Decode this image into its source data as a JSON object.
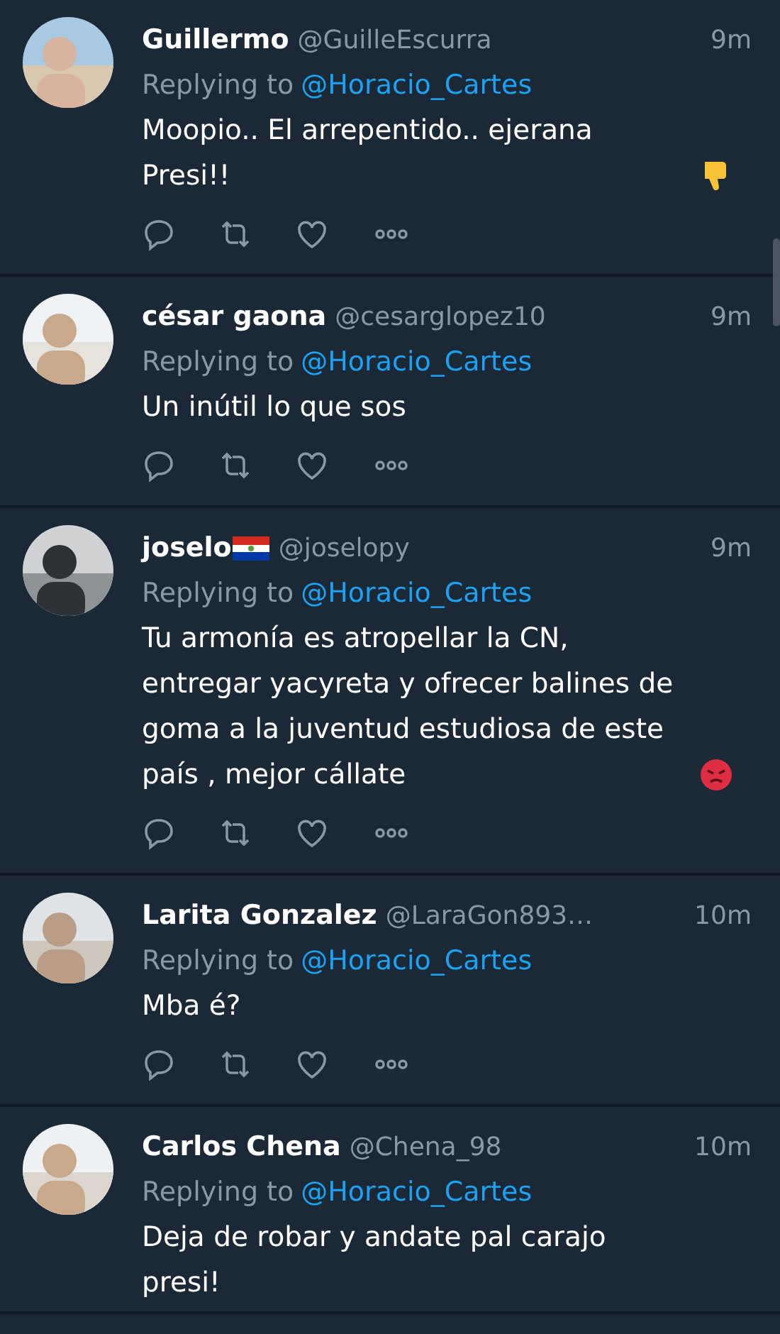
{
  "tweets": [
    {
      "name": "Guillermo",
      "handle": "@GuilleEscurra",
      "time": "9m",
      "replying_label": "Replying to",
      "replying_to": "@Horacio_Cartes",
      "text": "Moopio.. El arrepentido.. ejerana Presi!!",
      "emoji": {
        "kind": "thumbs-down"
      },
      "actions_visible": true
    },
    {
      "name": "césar gaona",
      "handle": "@cesarglopez10",
      "time": "9m",
      "replying_label": "Replying to",
      "replying_to": "@Horacio_Cartes",
      "text": "Un inútil lo que sos",
      "actions_visible": true
    },
    {
      "name": "joselo",
      "name_icon": {
        "kind": "flag"
      },
      "handle": "@joselopy",
      "time": "9m",
      "replying_label": "Replying to",
      "replying_to": "@Horacio_Cartes",
      "text": "Tu armonía es atropellar la CN, entregar yacyreta y ofrecer balines de goma a la juventud estudiosa de este país , mejor cállate",
      "emoji": {
        "kind": "angry"
      },
      "actions_visible": true
    },
    {
      "name": "Larita Gonzalez",
      "handle": "@LaraGon893…",
      "time": "10m",
      "replying_label": "Replying to",
      "replying_to": "@Horacio_Cartes",
      "text": "Mba é?",
      "actions_visible": true
    },
    {
      "name": "Carlos Chena",
      "handle": "@Chena_98",
      "time": "10m",
      "replying_label": "Replying to",
      "replying_to": "@Horacio_Cartes",
      "text": "Deja de robar y andate pal carajo presi!",
      "actions_visible": false
    }
  ]
}
